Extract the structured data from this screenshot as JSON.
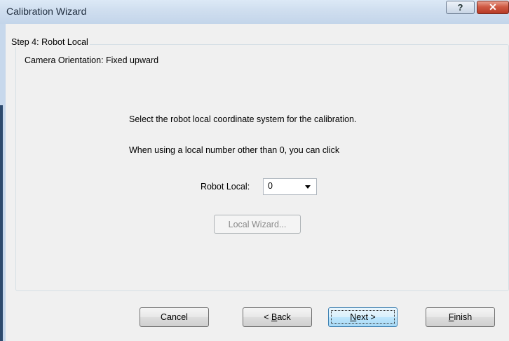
{
  "window": {
    "title": "Calibration Wizard",
    "help_glyph": "?",
    "close_glyph": "✕"
  },
  "step": {
    "label": "Step 4: Robot Local",
    "orientation": "Camera Orientation: Fixed upward",
    "instruction": "Select the robot local coordinate system for the calibration.",
    "note": "When using a local number other than 0, you can click",
    "robot_local_label": "Robot Local:",
    "robot_local_value": "0",
    "local_wizard_button": "Local Wizard..."
  },
  "buttons": {
    "cancel": "Cancel",
    "back_prefix": "< ",
    "back_key": "B",
    "back_rest": "ack",
    "next_key": "N",
    "next_rest": "ext >",
    "finish_key": "F",
    "finish_rest": "inish"
  }
}
